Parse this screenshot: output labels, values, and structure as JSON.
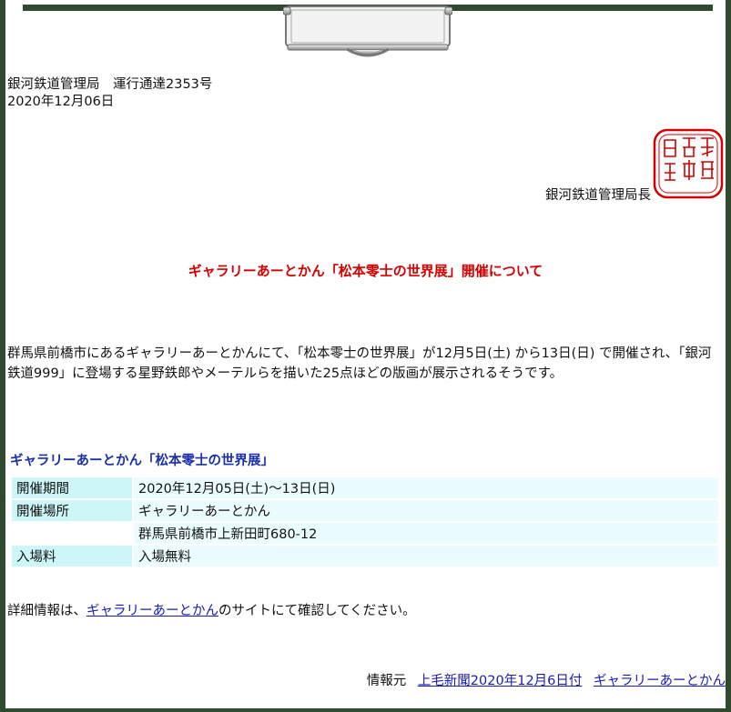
{
  "header": {
    "issuer_line": "銀河鉄道管理局　運行通達2353号",
    "date": "2020年12月06日"
  },
  "seal": {
    "text": "銀河鉄道管理局長印",
    "color": "#d40000"
  },
  "director": "銀河鉄道管理局長",
  "title": "ギャラリーあーとかん「松本零士の世界展」開催について",
  "body": "群馬県前橋市にあるギャラリーあーとかんにて、「松本零士の世界展」が12月5日(土) から13日(日) で開催され、「銀河鉄道999」に登場する星野鉄郎やメーテルらを描いた25点ほどの版画が展示されるそうです。",
  "event": {
    "title": "ギャラリーあーとかん「松本零士の世界展」",
    "rows": [
      {
        "label": "開催期間",
        "value": "2020年12月05日(土)～13日(日)"
      },
      {
        "label": "開催場所",
        "value": "ギャラリーあーとかん"
      },
      {
        "label": "",
        "value": "群馬県前橋市上新田町680-12"
      },
      {
        "label": "入場料",
        "value": "入場無料"
      }
    ]
  },
  "detail": {
    "prefix": "詳細情報は、",
    "link": "ギャラリーあーとかん",
    "suffix": "のサイトにて確認してください。"
  },
  "source": {
    "label": "情報元",
    "link1": "上毛新聞2020年12月6日付",
    "link2": "ギャラリーあーとかん"
  },
  "colors": {
    "frame": "#2f4a2f",
    "title": "#d40000",
    "table_title": "#1a2fa8",
    "label_bg": "#cdf6f8",
    "value_bg": "#eafcfd"
  }
}
